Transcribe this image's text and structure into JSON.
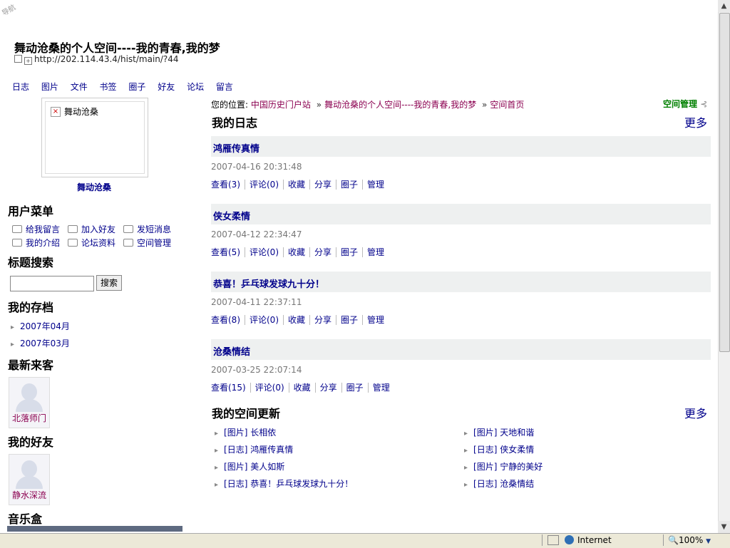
{
  "corner_label": "导航",
  "page_title": "舞动沧桑的个人空间----我的青春,我的梦",
  "url": "http://202.114.43.4/hist/main/?44",
  "nav": [
    "日志",
    "图片",
    "文件",
    "书签",
    "圈子",
    "好友",
    "论坛",
    "留言"
  ],
  "avatar": {
    "alt_text": "舞动沧桑",
    "name": "舞动沧桑"
  },
  "user_menu": {
    "title": "用户菜单",
    "items": [
      "给我留言",
      "加入好友",
      "发短消息",
      "我的介绍",
      "论坛资料",
      "空间管理"
    ]
  },
  "search": {
    "title": "标题搜索",
    "button": "搜索",
    "value": ""
  },
  "archive": {
    "title": "我的存档",
    "items": [
      "2007年04月",
      "2007年03月"
    ]
  },
  "visitors": {
    "title": "最新来客",
    "items": [
      "北落师门"
    ]
  },
  "friends": {
    "title": "我的好友",
    "items": [
      "静水深流"
    ]
  },
  "music": {
    "title": "音乐盒"
  },
  "breadcrumb": {
    "prefix": "您的位置:",
    "items": [
      "中国历史门户站",
      "舞动沧桑的个人空间----我的青春,我的梦",
      "空间首页"
    ],
    "separator": "»"
  },
  "admin_link": "空间管理",
  "blog": {
    "title": "我的日志",
    "more": "更多",
    "posts": [
      {
        "title": "鸿雁传真情",
        "date": "2007-04-16 20:31:48",
        "actions": [
          "查看(3)",
          "评论(0)",
          "收藏",
          "分享",
          "圈子",
          "管理"
        ]
      },
      {
        "title": "侠女柔情",
        "date": "2007-04-12 22:34:47",
        "actions": [
          "查看(5)",
          "评论(0)",
          "收藏",
          "分享",
          "圈子",
          "管理"
        ]
      },
      {
        "title": "恭喜！乒乓球发球九十分！",
        "date": "2007-04-11 22:37:11",
        "actions": [
          "查看(8)",
          "评论(0)",
          "收藏",
          "分享",
          "圈子",
          "管理"
        ]
      },
      {
        "title": "沧桑情结",
        "date": "2007-03-25 22:07:14",
        "actions": [
          "查看(15)",
          "评论(0)",
          "收藏",
          "分享",
          "圈子",
          "管理"
        ]
      }
    ]
  },
  "updates": {
    "title": "我的空间更新",
    "more": "更多",
    "left": [
      "[图片] 长相依",
      "[日志] 鸿雁传真情",
      "[图片] 美人如斯",
      "[日志] 恭喜！乒乓球发球九十分！"
    ],
    "right": [
      "[图片] 天地和谐",
      "[日志] 侠女柔情",
      "[图片] 宁静的美好",
      "[日志] 沧桑情结"
    ]
  },
  "statusbar": {
    "zone": "Internet",
    "zoom": "100%"
  }
}
